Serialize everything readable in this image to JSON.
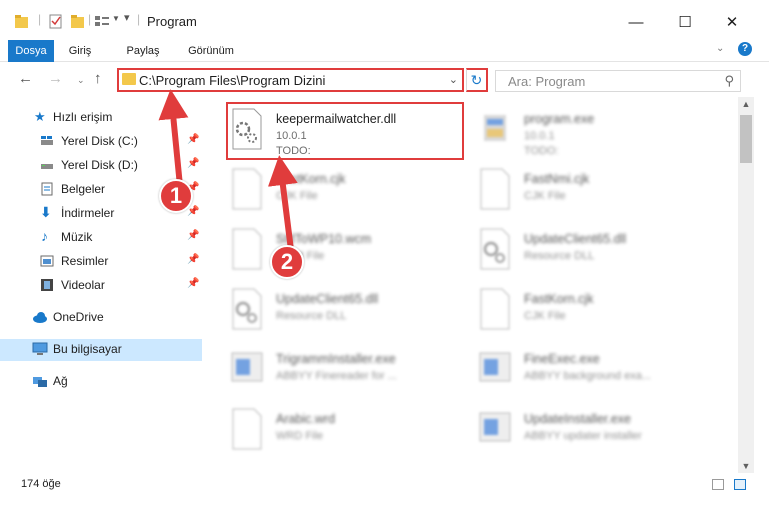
{
  "window": {
    "title": "Program",
    "minimize_icon": "minimize-icon",
    "maximize_icon": "maximize-icon",
    "close_icon": "close-icon"
  },
  "ribbon": {
    "tabs": [
      {
        "label": "Dosya",
        "active": true
      },
      {
        "label": "Giriş",
        "active": false
      },
      {
        "label": "Paylaş",
        "active": false
      },
      {
        "label": "Görünüm",
        "active": false
      }
    ]
  },
  "address": {
    "path": "C:\\Program Files\\Program Dizini",
    "search_placeholder": "Ara: Program"
  },
  "sidebar": {
    "items": [
      {
        "label": "Hızlı erişim",
        "icon": "star-icon"
      },
      {
        "label": "Yerel Disk (C:)",
        "icon": "drive-icon",
        "pinned": true
      },
      {
        "label": "Yerel Disk (D:)",
        "icon": "drive-icon",
        "pinned": true
      },
      {
        "label": "Belgeler",
        "icon": "documents-icon",
        "pinned": true
      },
      {
        "label": "İndirmeler",
        "icon": "download-icon",
        "pinned": true
      },
      {
        "label": "Müzik",
        "icon": "music-icon",
        "pinned": true
      },
      {
        "label": "Resimler",
        "icon": "pictures-icon",
        "pinned": true
      },
      {
        "label": "Videolar",
        "icon": "videos-icon",
        "pinned": true
      },
      {
        "label": "OneDrive",
        "icon": "cloud-icon"
      },
      {
        "label": "Bu bilgisayar",
        "icon": "computer-icon",
        "selected": true
      },
      {
        "label": "Ağ",
        "icon": "network-icon"
      }
    ]
  },
  "files": [
    {
      "name": "keepermailwatcher.dll",
      "line1": "10.0.1",
      "line2": "TODO:",
      "icon": "dll-gear-icon",
      "blurred": false
    },
    {
      "name": "program.exe",
      "line1": "10.0.1",
      "line2": "TODO:",
      "icon": "exe-icon",
      "blurred": true
    },
    {
      "name": "FastKorn.cjk",
      "line1": "CJK File",
      "line2": "",
      "icon": "file-icon",
      "blurred": true
    },
    {
      "name": "FastNmi.cjk",
      "line1": "CJK File",
      "line2": "",
      "icon": "file-icon",
      "blurred": true
    },
    {
      "name": "StdToWP10.wcm",
      "line1": "WCM File",
      "line2": "",
      "icon": "file-icon",
      "blurred": true
    },
    {
      "name": "UpdateClient65.dll",
      "line1": "Resource DLL",
      "line2": "",
      "icon": "dll-gear-icon",
      "blurred": true
    },
    {
      "name": "UpdateClient65.dll",
      "line1": "Resource DLL",
      "line2": "",
      "icon": "dll-gear-icon",
      "blurred": true
    },
    {
      "name": "FastKorn.cjk",
      "line1": "CJK File",
      "line2": "",
      "icon": "file-icon",
      "blurred": true
    },
    {
      "name": "TrigrammInstaller.exe",
      "line1": "ABBYY Finereader for ...",
      "line2": "",
      "icon": "window-icon",
      "blurred": true
    },
    {
      "name": "FineExec.exe",
      "line1": "ABBYY background exa...",
      "line2": "",
      "icon": "window-icon",
      "blurred": true
    },
    {
      "name": "Arabic.wrd",
      "line1": "WRD File",
      "line2": "",
      "icon": "file-icon",
      "blurred": true
    },
    {
      "name": "UpdateInstaller.exe",
      "line1": "ABBYY updater installer",
      "line2": "",
      "icon": "window-icon",
      "blurred": true
    }
  ],
  "status": {
    "count": "174 öğe"
  },
  "annotations": {
    "step1": "1",
    "step2": "2"
  },
  "colors": {
    "accent": "#1979ca",
    "highlight": "#e03c3c",
    "selected": "#cce8ff"
  }
}
